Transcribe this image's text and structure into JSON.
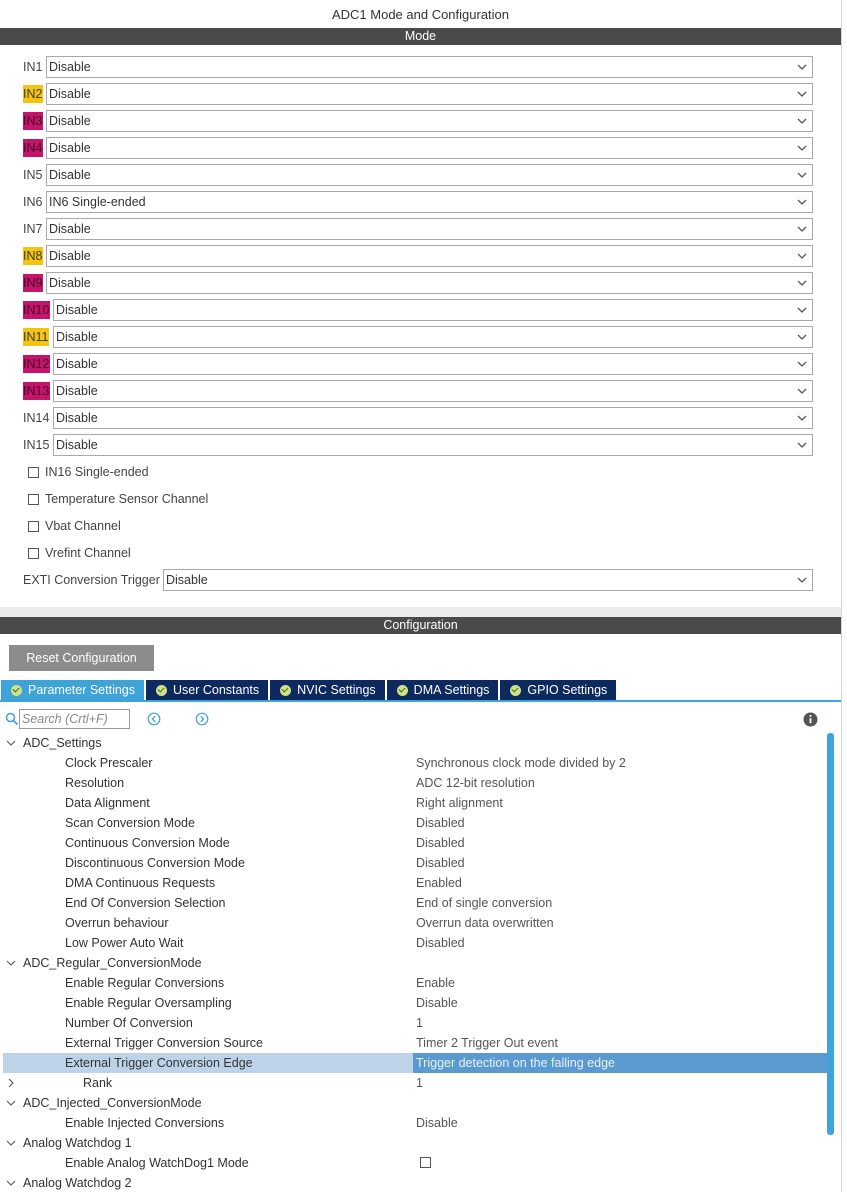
{
  "window": {
    "title": "ADC1 Mode and Configuration"
  },
  "mode": {
    "header": "Mode",
    "channels": [
      {
        "label": "IN1",
        "value": "Disable",
        "highlight": "none"
      },
      {
        "label": "IN2",
        "value": "Disable",
        "highlight": "yellow"
      },
      {
        "label": "IN3",
        "value": "Disable",
        "highlight": "magenta"
      },
      {
        "label": "IN4",
        "value": "Disable",
        "highlight": "magenta"
      },
      {
        "label": "IN5",
        "value": "Disable",
        "highlight": "none"
      },
      {
        "label": "IN6",
        "value": "IN6 Single-ended",
        "highlight": "none"
      },
      {
        "label": "IN7",
        "value": "Disable",
        "highlight": "none"
      },
      {
        "label": "IN8",
        "value": "Disable",
        "highlight": "yellow"
      },
      {
        "label": "IN9",
        "value": "Disable",
        "highlight": "magenta"
      },
      {
        "label": "IN10",
        "value": "Disable",
        "highlight": "magenta"
      },
      {
        "label": "IN11",
        "value": "Disable",
        "highlight": "yellow"
      },
      {
        "label": "IN12",
        "value": "Disable",
        "highlight": "magenta"
      },
      {
        "label": "IN13",
        "value": "Disable",
        "highlight": "magenta"
      },
      {
        "label": "IN14",
        "value": "Disable",
        "highlight": "none"
      },
      {
        "label": "IN15",
        "value": "Disable",
        "highlight": "none"
      }
    ],
    "checkboxes": [
      {
        "label": "IN16 Single-ended",
        "checked": false
      },
      {
        "label": "Temperature Sensor Channel",
        "checked": false
      },
      {
        "label": "Vbat Channel",
        "checked": false
      },
      {
        "label": "Vrefint Channel",
        "checked": false
      }
    ],
    "exti": {
      "label": "EXTI Conversion Trigger",
      "value": "Disable"
    }
  },
  "configuration": {
    "header": "Configuration",
    "reset_label": "Reset Configuration",
    "tabs": [
      {
        "label": "Parameter Settings",
        "active": true
      },
      {
        "label": "User Constants",
        "active": false
      },
      {
        "label": "NVIC Settings",
        "active": false
      },
      {
        "label": "DMA Settings",
        "active": false
      },
      {
        "label": "GPIO Settings",
        "active": false
      }
    ],
    "search": {
      "placeholder": "Search (Crtl+F)"
    },
    "tree": [
      {
        "type": "group",
        "label": "ADC_Settings",
        "expanded": true
      },
      {
        "type": "param",
        "label": "Clock Prescaler",
        "value": "Synchronous clock mode divided by 2"
      },
      {
        "type": "param",
        "label": "Resolution",
        "value": "ADC 12-bit resolution"
      },
      {
        "type": "param",
        "label": "Data Alignment",
        "value": "Right alignment"
      },
      {
        "type": "param",
        "label": "Scan Conversion Mode",
        "value": "Disabled"
      },
      {
        "type": "param",
        "label": "Continuous Conversion Mode",
        "value": "Disabled"
      },
      {
        "type": "param",
        "label": "Discontinuous Conversion Mode",
        "value": "Disabled"
      },
      {
        "type": "param",
        "label": "DMA Continuous Requests",
        "value": "Enabled"
      },
      {
        "type": "param",
        "label": "End Of Conversion Selection",
        "value": "End of single conversion"
      },
      {
        "type": "param",
        "label": "Overrun behaviour",
        "value": "Overrun data overwritten"
      },
      {
        "type": "param",
        "label": "Low Power Auto Wait",
        "value": "Disabled"
      },
      {
        "type": "group",
        "label": "ADC_Regular_ConversionMode",
        "expanded": true
      },
      {
        "type": "param",
        "label": "Enable Regular Conversions",
        "value": "Enable"
      },
      {
        "type": "param",
        "label": "Enable Regular Oversampling",
        "value": "Disable"
      },
      {
        "type": "param",
        "label": "Number Of Conversion",
        "value": "1"
      },
      {
        "type": "param",
        "label": "External Trigger Conversion Source",
        "value": "Timer 2 Trigger Out event"
      },
      {
        "type": "param",
        "label": "External Trigger Conversion Edge",
        "value": "Trigger detection on the falling edge",
        "selected": true
      },
      {
        "type": "subgroup",
        "label": "Rank",
        "value": "1",
        "expanded": false
      },
      {
        "type": "group",
        "label": "ADC_Injected_ConversionMode",
        "expanded": true
      },
      {
        "type": "param",
        "label": "Enable Injected Conversions",
        "value": "Disable"
      },
      {
        "type": "group",
        "label": "Analog Watchdog 1",
        "expanded": true
      },
      {
        "type": "checkparam",
        "label": "Enable Analog WatchDog1 Mode",
        "checked": false
      },
      {
        "type": "group",
        "label": "Analog Watchdog 2",
        "expanded": true
      }
    ]
  },
  "colors": {
    "highlight_yellow": "#f5c40c",
    "highlight_magenta": "#c4156c",
    "tab_active": "#3ea3d8",
    "tab_inactive": "#0c2960",
    "section_bar": "#4a4a4a",
    "selected_row": "#bcd3e8"
  },
  "icons": {
    "dropdown": "chevron-down-icon",
    "search": "search-icon",
    "prev": "previous-icon",
    "next": "next-icon",
    "info": "info-icon",
    "tab_status": "check-circle-icon"
  }
}
